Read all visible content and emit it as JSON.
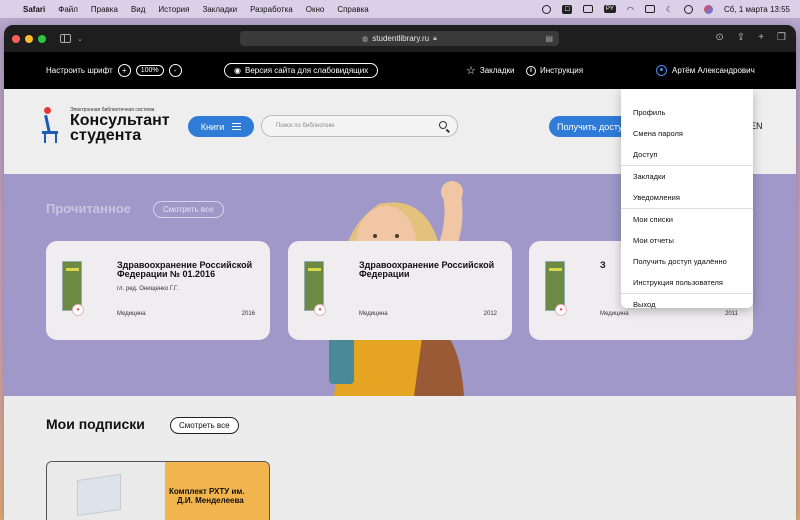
{
  "menubar": {
    "apple": "",
    "app": "Safari",
    "items": [
      "Файл",
      "Правка",
      "Вид",
      "История",
      "Закладки",
      "Разработка",
      "Окно",
      "Справка"
    ],
    "right": {
      "badge1": "☐",
      "badge2": "PY",
      "clock": "Сб, 1 марта  13:55"
    }
  },
  "browser": {
    "url": "studentlibrary.ru"
  },
  "sitebar": {
    "font_label": "Настроить шрифт",
    "plus": "+",
    "zoom": "100%",
    "minus": "-",
    "vision_label": "Версия сайта для слабовидящих",
    "bookmarks_label": "Закладки",
    "instruction_label": "Инструкция",
    "user_name": "Артём Александрович"
  },
  "header": {
    "logo_small": "Электронная библиотечная система",
    "logo_line1": "Консультант",
    "logo_line2": "студента",
    "books_label": "Книги",
    "search_placeholder": "Поиск по библиотеке",
    "access_label": "Получить доступ",
    "lang": "EN"
  },
  "hero": {
    "title": "Прочитанное",
    "see_all": "Смотреть все",
    "cards": [
      {
        "title": "Здравоохранение Российской Федерации № 01.2016",
        "author": "гл. ред. Онищенко Г.Г.",
        "category": "Медицина",
        "year": "2016"
      },
      {
        "title": "Здравоохранение Российской Федерации",
        "author": "",
        "category": "Медицина",
        "year": "2012"
      },
      {
        "title": "З",
        "author": "",
        "category": "Медицина",
        "year": "2011"
      }
    ]
  },
  "subs": {
    "title": "Мои подписки",
    "see_all": "Смотреть все",
    "card_line1": "Комплект РХТУ им.",
    "card_line2": "Д.И. Менделеева"
  },
  "dropdown": {
    "items": [
      "Профиль",
      "Смена пароля",
      "Доступ",
      "Закладки",
      "Уведомления",
      "Мои списки",
      "Мои отчеты",
      "Получить доступ удалённо",
      "Инструкция пользователя",
      "Выход"
    ]
  },
  "colors": {
    "accent_blue": "#2f7bd8",
    "hero_purple": "#9f98c9",
    "sub_orange": "#f2b44d",
    "lock_red": "#e05c63"
  },
  "icons": {
    "browser_left": [
      "sidebar-icon",
      "chevron-down-icon"
    ],
    "browser_right": [
      "download-icon",
      "share-icon",
      "new-tab-icon",
      "tabs-overview-icon"
    ],
    "sitebar": [
      "eye-icon",
      "star-icon",
      "info-icon",
      "user-icon"
    ],
    "menubar_right": [
      "focus-icon",
      "battery-icon",
      "input-source-icon",
      "wifi-icon",
      "display-icon",
      "moon-icon",
      "control-center-icon",
      "siri-icon"
    ]
  }
}
